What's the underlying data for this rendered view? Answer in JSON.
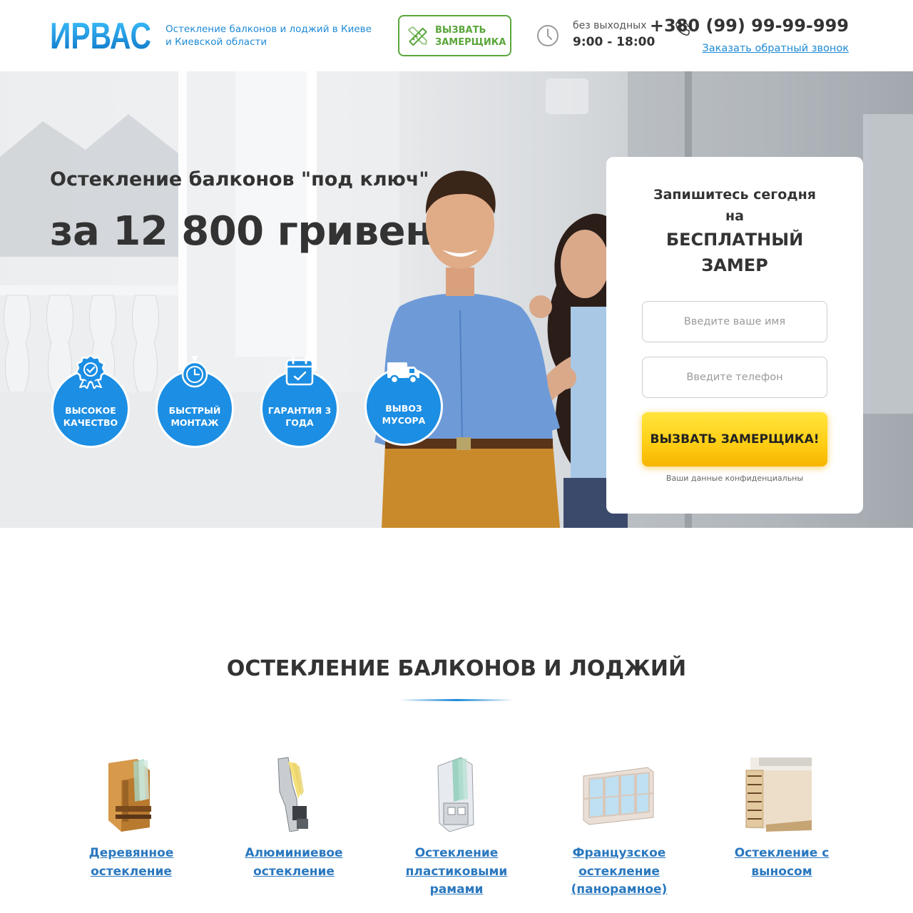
{
  "header": {
    "logo_text": "ИРВАС",
    "tagline": "Остекление балконов и лоджий в Киеве и Киевской области",
    "call_button": "ВЫЗВАТЬ ЗАМЕРЩИКА",
    "hours_label": "без выходных",
    "hours_value": "9:00 - 18:00",
    "phone": "+380 (99) 99-99-999",
    "callback_link": "Заказать обратный звонок"
  },
  "hero": {
    "title": "Остекление балконов \"под ключ\"",
    "price": "за 12 800 гривен!",
    "features": [
      {
        "label": "ВЫСОКОЕ КАЧЕСТВО",
        "icon": "quality-badge-icon"
      },
      {
        "label": "БЫСТРЫЙ МОНТАЖ",
        "icon": "stopwatch-icon"
      },
      {
        "label": "ГАРАНТИЯ 3 ГОДА",
        "icon": "calendar-icon"
      },
      {
        "label": "ВЫВОЗ МУСОРА",
        "icon": "truck-icon"
      }
    ]
  },
  "form": {
    "line1": "Запишитесь сегодня",
    "line2": "на",
    "line3": "БЕСПЛАТНЫЙ",
    "line4": "ЗАМЕР",
    "name_placeholder": "Введите ваше имя",
    "phone_placeholder": "Введите телефон",
    "submit": "ВЫЗВАТЬ ЗАМЕРЩИКА!",
    "privacy": "Ваши данные конфиденциальны"
  },
  "section": {
    "title": "ОСТЕКЛЕНИЕ БАЛКОНОВ И ЛОДЖИЙ",
    "categories": [
      {
        "label": "Деревянное остекление",
        "icon": "wooden-window-profile-icon"
      },
      {
        "label": "Алюминиевое остекление",
        "icon": "aluminium-profile-icon"
      },
      {
        "label": "Остекление пластиковыми рамами",
        "icon": "plastic-frame-profile-icon"
      },
      {
        "label": "Французское остекление (панорамное)",
        "icon": "panoramic-balcony-icon"
      },
      {
        "label": "Остекление с выносом",
        "icon": "extended-balcony-icon"
      }
    ]
  },
  "colors": {
    "brand_blue": "#1e8ad6",
    "feature_blue": "#1c8ee3",
    "green": "#5aa63b",
    "yellow": "#ffcf16",
    "text_dark": "#333333"
  }
}
